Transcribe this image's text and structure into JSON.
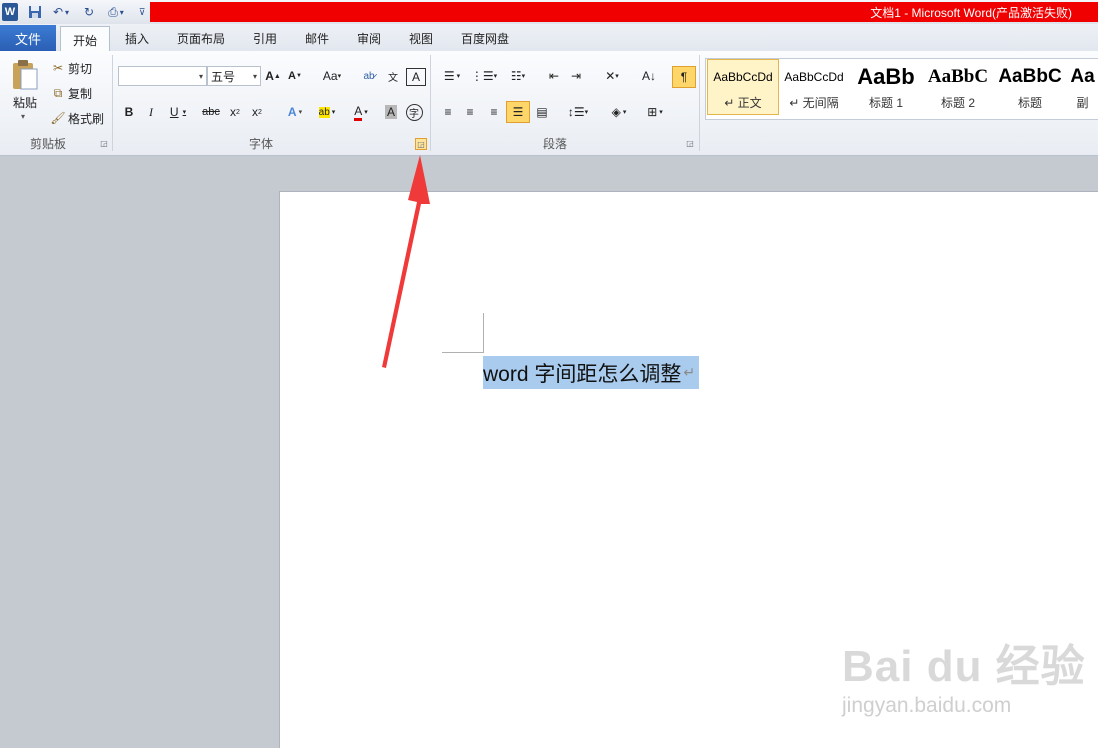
{
  "titlebar": {
    "title": "文档1 - Microsoft Word(产品激活失败)",
    "app_logo": "W"
  },
  "tabs": [
    {
      "label": "文件"
    },
    {
      "label": "开始"
    },
    {
      "label": "插入"
    },
    {
      "label": "页面布局"
    },
    {
      "label": "引用"
    },
    {
      "label": "邮件"
    },
    {
      "label": "审阅"
    },
    {
      "label": "视图"
    },
    {
      "label": "百度网盘"
    }
  ],
  "clipboard": {
    "paste": "粘贴",
    "cut": "剪切",
    "copy": "复制",
    "format_painter": "格式刷",
    "group_label": "剪贴板"
  },
  "font": {
    "font_name": "",
    "font_size": "五号",
    "group_label": "字体"
  },
  "paragraph": {
    "group_label": "段落"
  },
  "styles": [
    {
      "sample": "AaBbCcDd",
      "name": "↵ 正文"
    },
    {
      "sample": "AaBbCcDd",
      "name": "↵ 无间隔"
    },
    {
      "sample": "AaBb",
      "name": "标题 1"
    },
    {
      "sample": "AaBbC",
      "name": "标题 2"
    },
    {
      "sample": "AaBbC",
      "name": "标题"
    },
    {
      "sample": "Aa",
      "name": "副"
    }
  ],
  "document": {
    "text": "word 字间距怎么调整",
    "paragraph_mark": "↵"
  },
  "watermark": {
    "logo": "Bai du 经验",
    "url": "jingyan.baidu.com"
  },
  "colors": {
    "accent": "#2a5fb4",
    "title_bar": "#f00000",
    "selection": "#a9ccee",
    "arrow": "#f03a3a"
  }
}
